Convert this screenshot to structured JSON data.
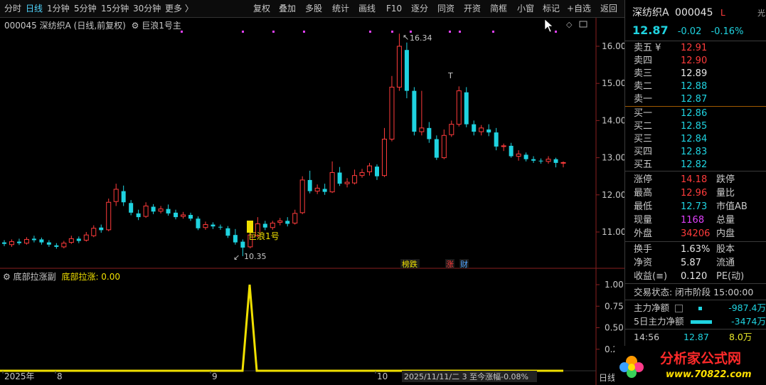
{
  "toolbar": {
    "left_items": [
      "分时",
      "日线",
      "1分钟",
      "5分钟",
      "15分钟",
      "30分钟",
      "更多 〉"
    ],
    "right_items": [
      "复权",
      "叠加",
      "多股",
      "统计",
      "画线",
      "F10",
      "逐分",
      "同资",
      "开资",
      "简框",
      "小窗",
      "标记",
      "+自选",
      "返回"
    ],
    "active": "日线"
  },
  "info": {
    "code_name": "000045 深纺织A (日线,前复权)",
    "indicator": "巨浪1号主",
    "sub_indicator": "底部拉涨副",
    "sub_value_label": "底部拉涨: 0.00"
  },
  "chart_data": {
    "type": "candlestick",
    "title": "000045 深纺织A (日线,前复权)",
    "price_axis": {
      "ticks": [
        16.0,
        15.0,
        14.0,
        13.0,
        12.0,
        11.0
      ],
      "range": [
        10.1,
        16.6
      ]
    },
    "annotations": {
      "high": "16.34",
      "low": "10.35",
      "signal": "巨浪1号",
      "mark_t": "T"
    },
    "x_ticks": [
      "2025年",
      "8",
      "9",
      "10"
    ],
    "cursor_label": "2025/11/11/二 3 至今涨幅-0.08%",
    "badges": [
      "榜跌",
      "涨",
      "财"
    ],
    "candles": [
      [
        10.72,
        10.68,
        10.78,
        10.62
      ],
      [
        10.66,
        10.74,
        10.8,
        10.6
      ],
      [
        10.74,
        10.7,
        10.82,
        10.65
      ],
      [
        10.7,
        10.8,
        10.86,
        10.66
      ],
      [
        10.82,
        10.78,
        10.9,
        10.72
      ],
      [
        10.8,
        10.72,
        10.85,
        10.66
      ],
      [
        10.72,
        10.66,
        10.78,
        10.6
      ],
      [
        10.64,
        10.6,
        10.7,
        10.55
      ],
      [
        10.6,
        10.7,
        10.76,
        10.56
      ],
      [
        10.72,
        10.82,
        10.9,
        10.68
      ],
      [
        10.82,
        10.76,
        10.88,
        10.7
      ],
      [
        10.78,
        10.92,
        11.0,
        10.74
      ],
      [
        10.9,
        11.1,
        11.18,
        10.86
      ],
      [
        11.12,
        11.05,
        11.2,
        10.98
      ],
      [
        11.06,
        11.8,
        11.9,
        11.02
      ],
      [
        11.82,
        12.15,
        12.3,
        11.7
      ],
      [
        12.1,
        11.8,
        12.25,
        11.7
      ],
      [
        11.78,
        11.52,
        11.86,
        11.45
      ],
      [
        11.5,
        11.4,
        11.6,
        11.32
      ],
      [
        11.42,
        11.7,
        11.8,
        11.38
      ],
      [
        11.68,
        11.55,
        11.75,
        11.48
      ],
      [
        11.56,
        11.62,
        11.7,
        11.5
      ],
      [
        11.62,
        11.5,
        11.74,
        11.44
      ],
      [
        11.52,
        11.4,
        11.6,
        11.34
      ],
      [
        11.42,
        11.46,
        11.54,
        11.36
      ],
      [
        11.46,
        11.36,
        11.52,
        11.3
      ],
      [
        11.36,
        11.1,
        11.42,
        11.05
      ],
      [
        11.12,
        11.2,
        11.28,
        11.06
      ],
      [
        11.2,
        11.15,
        11.26,
        11.08
      ],
      [
        11.14,
        11.12,
        11.2,
        11.06
      ],
      [
        11.1,
        10.9,
        11.16,
        10.84
      ],
      [
        10.92,
        10.72,
        11.08,
        10.66
      ],
      [
        10.74,
        10.58,
        10.8,
        10.35
      ],
      [
        10.6,
        10.92,
        11.0,
        10.56
      ],
      [
        10.9,
        11.22,
        11.4,
        10.86
      ],
      [
        11.22,
        11.12,
        11.3,
        11.05
      ],
      [
        11.12,
        11.24,
        11.3,
        11.06
      ],
      [
        11.26,
        11.3,
        11.38,
        11.18
      ],
      [
        11.3,
        11.22,
        11.4,
        11.15
      ],
      [
        11.24,
        11.5,
        11.6,
        11.2
      ],
      [
        11.52,
        12.4,
        12.5,
        11.48
      ],
      [
        12.4,
        12.1,
        12.65,
        12.04
      ],
      [
        12.1,
        12.18,
        12.28,
        12.02
      ],
      [
        12.16,
        12.08,
        12.3,
        12.0
      ],
      [
        12.08,
        12.6,
        12.9,
        12.05
      ],
      [
        12.6,
        12.3,
        12.75,
        12.24
      ],
      [
        12.3,
        12.34,
        12.45,
        12.2
      ],
      [
        12.32,
        12.52,
        12.68,
        12.28
      ],
      [
        12.52,
        12.6,
        12.7,
        12.46
      ],
      [
        12.62,
        12.78,
        12.86,
        12.52
      ],
      [
        12.76,
        12.5,
        12.82,
        12.4
      ],
      [
        12.52,
        13.5,
        13.8,
        12.48
      ],
      [
        13.5,
        14.9,
        15.2,
        13.44
      ],
      [
        14.9,
        16.0,
        16.34,
        14.8
      ],
      [
        15.9,
        14.8,
        16.1,
        14.6
      ],
      [
        14.8,
        13.7,
        14.9,
        13.6
      ],
      [
        13.7,
        13.8,
        14.8,
        13.6
      ],
      [
        13.8,
        13.5,
        13.96,
        13.4
      ],
      [
        13.5,
        13.0,
        13.6,
        12.94
      ],
      [
        13.0,
        13.6,
        13.76,
        12.96
      ],
      [
        13.62,
        13.9,
        14.0,
        13.56
      ],
      [
        13.9,
        14.8,
        14.92,
        13.84
      ],
      [
        14.76,
        13.9,
        14.9,
        13.82
      ],
      [
        13.9,
        13.7,
        14.0,
        13.6
      ],
      [
        13.7,
        13.8,
        13.88,
        13.6
      ],
      [
        13.76,
        13.68,
        13.9,
        13.58
      ],
      [
        13.68,
        13.3,
        13.8,
        13.2
      ],
      [
        13.3,
        13.32,
        13.38,
        13.18
      ],
      [
        13.32,
        13.04,
        13.4,
        13.0
      ],
      [
        13.04,
        13.1,
        13.2,
        12.92
      ],
      [
        13.08,
        12.96,
        13.14,
        12.9
      ],
      [
        12.96,
        12.92,
        13.04,
        12.86
      ],
      [
        12.92,
        12.9,
        12.98,
        12.84
      ],
      [
        12.9,
        12.96,
        13.04,
        12.84
      ],
      [
        12.96,
        12.86,
        13.0,
        12.74
      ],
      [
        12.86,
        12.87,
        12.9,
        12.74
      ]
    ],
    "sub_panel": {
      "axis_ticks": [
        "1.00",
        "0.75",
        "0.50",
        "0.25"
      ],
      "spike_value": 1.0
    }
  },
  "panel": {
    "name": "深纺织A",
    "code": "000045",
    "flag": "L",
    "price": "12.87",
    "change": "-0.02",
    "change_pct": "-0.16%",
    "asks": [
      [
        "卖五 ¥",
        "12.91"
      ],
      [
        "卖四",
        "12.90"
      ],
      [
        "卖三",
        "12.89"
      ],
      [
        "卖二",
        "12.88"
      ],
      [
        "卖一",
        "12.87"
      ]
    ],
    "bids": [
      [
        "买一",
        "12.86"
      ],
      [
        "买二",
        "12.85"
      ],
      [
        "买三",
        "12.84"
      ],
      [
        "买四",
        "12.83"
      ],
      [
        "买五",
        "12.82"
      ]
    ],
    "stats": [
      [
        "涨停",
        "14.18",
        "跌停",
        ""
      ],
      [
        "最高",
        "12.96",
        "量比",
        ""
      ],
      [
        "最低",
        "12.73",
        "市值AB",
        ""
      ],
      [
        "现量",
        "1168",
        "总量",
        ""
      ],
      [
        "外盘",
        "34206",
        "内盘",
        ""
      ]
    ],
    "fund": [
      [
        "换手",
        "1.63%",
        "股本",
        ""
      ],
      [
        "净资",
        "5.87",
        "流通",
        ""
      ],
      [
        "收益(≡)",
        "0.120",
        "PE(动)",
        ""
      ]
    ],
    "trade_status": "交易状态: 闭市阶段 15:00:00",
    "main_net": [
      "主力净额",
      "-987.4万"
    ],
    "five_day_net": [
      "5日主力净额",
      "-3474万"
    ],
    "tick": [
      "14:56",
      "12.87",
      "8.0万"
    ],
    "top_right": "光"
  },
  "footer": {
    "period": "日线"
  },
  "logo": {
    "text": "分析家公式网",
    "url_text": "www.70822.com"
  },
  "colors": {
    "up": "#ff3b3b",
    "down": "#1fd3e0",
    "signal": "#f0e000"
  }
}
